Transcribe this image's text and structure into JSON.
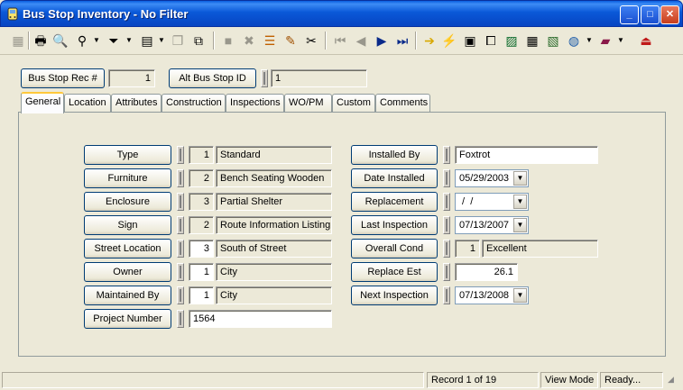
{
  "window": {
    "title": "Bus Stop Inventory - No Filter",
    "minimize": "_",
    "maximize": "□",
    "close": "✕"
  },
  "toolbar": {
    "icons": [
      "save-icon",
      "print-icon",
      "print-preview-icon",
      "find-icon",
      "filter-icon",
      "report-icon",
      "copy-record-icon",
      "duplicate-icon",
      "stop-icon",
      "delete-icon",
      "layers-icon",
      "edit-pencil-icon",
      "cut-icon",
      "first-record-icon",
      "previous-record-icon",
      "next-record-icon",
      "last-record-icon",
      "go-arrow-icon",
      "lightning-icon",
      "map-icon",
      "hierarchy-icon",
      "image-icon",
      "calculator-icon",
      "map-view-icon",
      "globe-icon",
      "book-icon",
      "exit-icon"
    ]
  },
  "header": {
    "rec_label": "Bus Stop Rec #",
    "rec_value": "1",
    "alt_label": "Alt Bus Stop ID",
    "alt_value": "1"
  },
  "tabs": [
    "General",
    "Location",
    "Attributes",
    "Construction",
    "Inspections",
    "WO/PM",
    "Custom",
    "Comments"
  ],
  "left": {
    "type": {
      "label": "Type",
      "code": "1",
      "text": "Standard"
    },
    "furniture": {
      "label": "Furniture",
      "code": "2",
      "text": "Bench Seating Wooden"
    },
    "enclosure": {
      "label": "Enclosure",
      "code": "3",
      "text": "Partial Shelter"
    },
    "sign": {
      "label": "Sign",
      "code": "2",
      "text": "Route Information Listing"
    },
    "street": {
      "label": "Street Location",
      "code": "3",
      "text": "South of Street"
    },
    "owner": {
      "label": "Owner",
      "code": "1",
      "text": "City"
    },
    "maintained": {
      "label": "Maintained By",
      "code": "1",
      "text": "City"
    },
    "project": {
      "label": "Project Number",
      "value": "1564"
    }
  },
  "right": {
    "installed_by": {
      "label": "Installed By",
      "value": "Foxtrot"
    },
    "date_installed": {
      "label": "Date Installed",
      "value": "05/29/2003"
    },
    "replacement": {
      "label": "Replacement",
      "value": " /  /"
    },
    "last_inspection": {
      "label": "Last Inspection",
      "value": "07/13/2007"
    },
    "overall_cond": {
      "label": "Overall Cond",
      "code": "1",
      "text": "Excellent"
    },
    "replace_est": {
      "label": "Replace Est",
      "value": "26.1"
    },
    "next_inspection": {
      "label": "Next Inspection",
      "value": "07/13/2008"
    }
  },
  "status": {
    "record": "Record 1 of 19",
    "mode": "View Mode",
    "ready": "Ready..."
  }
}
